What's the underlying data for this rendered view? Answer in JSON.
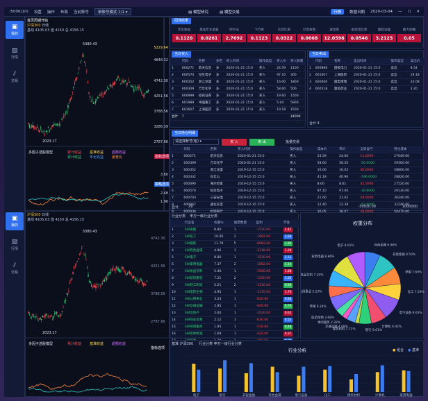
{
  "title_bar": {
    "app_name": "i5006(10)",
    "menu": [
      "设置",
      "操作",
      "布局",
      "当前账号"
    ],
    "mode_select": "单账号模式 1/1",
    "center_tabs": [
      "模型研究",
      "模型交易"
    ],
    "right_pill": "行情",
    "right_text": "数据日期",
    "date": "2020-03-04"
  },
  "rail_top": {
    "items": [
      {
        "label": "我的",
        "icon": "monitor-icon"
      },
      {
        "label": "行情",
        "icon": "image-icon"
      },
      {
        "label": "交易",
        "icon": "slash-icon"
      }
    ]
  },
  "rail_bottom": {
    "items": [
      {
        "label": "我的",
        "icon": "monitor-icon"
      },
      {
        "label": "行情",
        "icon": "image-icon"
      },
      {
        "label": "交易",
        "icon": "slash-icon"
      }
    ]
  },
  "top_chart": {
    "header_title": "首页周期开始",
    "index_name": "沪深300",
    "indicators": "日线",
    "sub": "基线 4105.03 值 4150 总 4156.15",
    "peak_label": "5380.43",
    "low_label": "2023.17",
    "y_ticks": [
      "5229.64",
      "4848.32",
      "4742.30",
      "4251.56",
      "3788.56",
      "3286.39",
      "2787.66"
    ],
    "ind_title": "多因子选股模型",
    "ind_legend": [
      "累计收益",
      "基准收益",
      "超额收益"
    ],
    "ind_legend2": [
      "累计收益",
      "年化收益",
      "夏普比"
    ],
    "ind_ticks": [
      "3.60",
      "3.08",
      "2.48",
      "1.96",
      "1.44",
      "0.92"
    ],
    "right_badges": [
      "指标选项",
      "策略选项"
    ]
  },
  "bottom_chart": {
    "index_name": "沪深300",
    "indicators": "日线",
    "sub": "基线 4105.03 值 4150 总 4156.15",
    "peak_label": "5380.43",
    "low_label": "2023.17",
    "y_ticks": [
      "5229.64",
      "4742.30",
      "4251.56",
      "3788.56",
      "3286.39",
      "2787.66"
    ],
    "ind_title": "多因子选股模型",
    "ind_legend": [
      "累计收益",
      "基准收益",
      "超额收益"
    ],
    "right_badges": [
      "指标选项"
    ]
  },
  "stats": {
    "title": "回测结果",
    "items": [
      {
        "label": "年化收益",
        "value": "0.1120"
      },
      {
        "label": "基准年化收益",
        "value": "0.0261"
      },
      {
        "label": "阿尔法",
        "value": "2.7692"
      },
      {
        "label": "下行率",
        "value": "0.1123"
      },
      {
        "label": "信息比率",
        "value": "0.0322"
      },
      {
        "label": "贝塔系数",
        "value": "0.0068"
      },
      {
        "label": "波动率",
        "value": "12.0596"
      },
      {
        "label": "索提诺比率",
        "value": "0.0546"
      },
      {
        "label": "跟踪误差",
        "value": "3.2125"
      },
      {
        "label": "最大回撤",
        "value": "0.05"
      }
    ]
  },
  "buy_table": {
    "title": "当日买入",
    "columns": [
      "",
      "代码",
      "名称",
      "多空",
      "买入时间",
      "操作类型",
      "买入价",
      "买入数量"
    ],
    "rows": [
      [
        "1",
        "600271",
        "航天信息",
        "多",
        "2020-01-21 15:0",
        "买入",
        "24.59",
        "1100"
      ],
      [
        "2",
        "600570",
        "恒生电子",
        "多",
        "2020-01-21 15:0",
        "买入",
        "97.10",
        "300"
      ],
      [
        "3",
        "600352",
        "浙江龙盛",
        "多",
        "2020-01-21 15:0",
        "买入",
        "16.00",
        "1800"
      ],
      [
        "4",
        "600309",
        "万华化学",
        "多",
        "2020-01-21 15:0",
        "买入",
        "58.60",
        "500"
      ],
      [
        "5",
        "600999",
        "招商证券",
        "多",
        "2020-01-21 15:0",
        "买入",
        "19.60",
        "1500"
      ],
      [
        "6",
        "601989",
        "中国重工",
        "多",
        "2020-01-21 15:0",
        "买入",
        "5.04",
        "5900"
      ],
      [
        "7",
        "601607",
        "上海医药",
        "多",
        "2020-01-21 15:0",
        "买入",
        "19.18",
        "1500"
      ]
    ],
    "sum_label": "合计",
    "sum_count": "7",
    "sum_qty": "14000"
  },
  "sell_table": {
    "title": "当日卖出",
    "columns": [
      "",
      "代码",
      "名称",
      "卖出时间",
      "操作类型",
      "卖出价"
    ],
    "rows": [
      [
        "1",
        "600886",
        "国投电力",
        "2020-01-21 15:0",
        "卖出",
        "8.54"
      ],
      [
        "2",
        "601607",
        "上海医药",
        "2020-01-21 15:0",
        "卖出",
        "19.18"
      ],
      [
        "3",
        "600406",
        "国电南瑞",
        "2020-01-21 15:0",
        "卖出",
        "24.08"
      ],
      [
        "4",
        "600518",
        "康美药业",
        "2020-01-21 15:0",
        "卖出",
        "3.20"
      ]
    ],
    "sum_label": "合计",
    "sum_count": "4"
  },
  "hold_table": {
    "title": "当日持仓明细",
    "select_label": "请选择账号(组)",
    "btn_buy": "买 入",
    "btn_sell": "卖 出",
    "btn_batch": "批量交易",
    "columns": [
      "",
      "代码",
      "名称",
      "买入时间",
      "操作类型",
      "成本价",
      "市价",
      "当日盈亏",
      "持仓成本"
    ],
    "rows": [
      [
        "1",
        "600271",
        "航天信息",
        "2020-01-21 15:0",
        "买入",
        "24.59",
        "24.60",
        "11.0000",
        "27049.00"
      ],
      [
        "2",
        "600309",
        "万华化学",
        "2020-01-21 15:0",
        "买入",
        "58.60",
        "58.50",
        "-50.0000",
        "29300.00"
      ],
      [
        "3",
        "600352",
        "浙江龙盛",
        "2019-12-15 15:0",
        "买入",
        "16.00",
        "16.02",
        "36.0000",
        "28800.00"
      ],
      [
        "4",
        "600332",
        "白云山",
        "2019-12-15 15:0",
        "买入",
        "41.18",
        "40.90",
        "-196.0000",
        "28826.00"
      ],
      [
        "5",
        "600690",
        "海尔智家",
        "2019-12-15 15:0",
        "买入",
        "8.60",
        "8.61",
        "32.0000",
        "27520.00"
      ],
      [
        "6",
        "600570",
        "恒生电子",
        "2019-12-15 15:0",
        "买入",
        "97.10",
        "97.00",
        "-30.0000",
        "29130.00"
      ],
      [
        "7",
        "600703",
        "三安光电",
        "2019-12-15 15:0",
        "买入",
        "21.60",
        "21.62",
        "28.0000",
        "30240.00"
      ],
      [
        "8",
        "600867",
        "通化东宝",
        "2019-12-15 15:0",
        "买入",
        "12.40",
        "12.38",
        "-52.0000",
        "32240.00"
      ],
      [
        "9",
        "600036",
        "招商银行",
        "2019-12-15 15:0",
        "买入",
        "36.05",
        "36.07",
        "28.0000",
        "50470.00"
      ],
      [
        "10",
        "600999",
        "招商证券",
        "2020-01-21 15:0",
        "买入",
        "19.60",
        "19.62",
        "30.0000",
        "29400.00"
      ],
      [
        "11",
        "601989",
        "中国重工",
        "2020-01-21 15:0",
        "买入",
        "5.04",
        "5.03",
        "-59.0000",
        "29736.00"
      ]
    ],
    "sum_label": "合计",
    "sum_count": "29",
    "sum_pnl": "-30930.00",
    "sum_cost": "1000000"
  },
  "industry_table": {
    "tabs": [
      "行业分类",
      "申万一级行业分类"
    ],
    "columns": [
      "",
      "行业名",
      "权重%",
      "股票数量",
      "盈利",
      "市值"
    ],
    "rows": [
      [
        "1",
        "SW采掘",
        "8.80",
        "1",
        "-1510.00",
        "2.47"
      ],
      [
        "2",
        "SW化工",
        "10.00",
        "2",
        "-1082.00",
        "2.68"
      ],
      [
        "3",
        "SW钢铁",
        "11.79",
        "5",
        "-6082.00",
        "1.95"
      ],
      [
        "4",
        "SW有色金属",
        "4.96",
        "1",
        "-2218.00",
        "1.29"
      ],
      [
        "5",
        "SW电子",
        "8.80",
        "1",
        "-1510.00",
        "3.12"
      ],
      [
        "6",
        "SW家用电器",
        "7.37",
        "2",
        "-1862.00",
        "2.21"
      ],
      [
        "7",
        "SW食品饮料",
        "5.40",
        "1",
        "-3500.00",
        "1.88"
      ],
      [
        "8",
        "SW纺织服装",
        "7.21",
        "2",
        "-1250.00",
        "1.02"
      ],
      [
        "9",
        "SW轻工制造",
        "5.21",
        "2",
        "-1110.00",
        "0.94"
      ],
      [
        "10",
        "SW医药生物",
        "4.95",
        "1",
        "-1370.00",
        "1.76"
      ],
      [
        "11",
        "SW公用事业",
        "3.24",
        "1",
        "-820.00",
        "0.88"
      ],
      [
        "12",
        "SW交通运输",
        "2.85",
        "1",
        "-940.00",
        "0.74"
      ],
      [
        "13",
        "SW房地产",
        "2.60",
        "1",
        "-1020.00",
        "0.61"
      ],
      [
        "14",
        "SW商业贸易",
        "2.12",
        "1",
        "-630.00",
        "0.52"
      ],
      [
        "15",
        "SW休闲服务",
        "1.95",
        "1",
        "-510.00",
        "0.48"
      ],
      [
        "16",
        "SW农林牧渔",
        "1.69",
        "1",
        "-420.00",
        "0.37"
      ],
      [
        "17",
        "SW综合",
        "1.20",
        "1",
        "-300.00",
        "0.29"
      ]
    ],
    "sum_label": "合计",
    "sum_w": "100.00",
    "sum_n": "29",
    "sum_pnl": "-43328.00",
    "sum_mv": "100.0"
  },
  "pie": {
    "title": "权重分布",
    "labels": [
      "有色金属 6.96%",
      "非银金融 8.50%",
      "采掘 7.69%",
      "化工 7.29%",
      "电气设备 9.63%",
      "计算机 6.92%",
      "银行 5.61%",
      "建筑材料 1.72%",
      "交通运输 4.08%",
      "休闲服务 2.28%",
      "医药生物 3.68%",
      "传媒 6.34%",
      "公用事业 5.23%",
      "食品饮料 7.20%",
      "家用电器 8.86%",
      "电子 8.01%"
    ]
  },
  "bars": {
    "tabs": [
      "基准 沪深300",
      "行业分类 申万一级行业分类"
    ],
    "title": "行业分析",
    "legend": [
      "组合",
      "基准"
    ],
    "categories": [
      "电子",
      "银行",
      "非银金融",
      "有色金属",
      "电气设备",
      "化工",
      "建筑材料",
      "计算机",
      "家用电器"
    ]
  },
  "chart_data": [
    {
      "type": "pie",
      "title": "权重分布",
      "labels": [
        "有色金属",
        "非银金融",
        "采掘",
        "化工",
        "电气设备",
        "计算机",
        "银行",
        "建筑材料",
        "交通运输",
        "休闲服务",
        "医药生物",
        "传媒",
        "公用事业",
        "食品饮料",
        "家用电器",
        "电子"
      ],
      "values": [
        6.96,
        8.5,
        7.69,
        7.29,
        9.63,
        6.92,
        5.61,
        1.72,
        4.08,
        2.28,
        3.68,
        6.34,
        5.23,
        7.2,
        8.86,
        8.01
      ],
      "colors": [
        "#3c7df0",
        "#2ec4c4",
        "#ff8a3c",
        "#ffd23c",
        "#8f5cf0",
        "#f04f6e",
        "#2ed07a",
        "#c0d84a",
        "#5aa0ff",
        "#ff5ac8",
        "#4ae0a0",
        "#7d6bff",
        "#ff6f4a",
        "#37b3ff",
        "#e0e040",
        "#b05cff"
      ]
    },
    {
      "type": "bar",
      "title": "行业分析",
      "categories": [
        "电子",
        "银行",
        "非银金融",
        "有色金属",
        "电气设备",
        "化工",
        "建筑材料",
        "计算机",
        "家用电器"
      ],
      "series": [
        {
          "name": "组合",
          "values": [
            0.78,
            0.65,
            0.52,
            0.7,
            0.45,
            0.62,
            0.35,
            0.55,
            0.6
          ]
        },
        {
          "name": "基准",
          "values": [
            0.62,
            0.88,
            0.8,
            0.55,
            0.7,
            0.72,
            0.5,
            0.74,
            0.58
          ]
        }
      ],
      "ylim": [
        0,
        1
      ]
    }
  ],
  "colors": {
    "accent": "#2f6ff0",
    "red_stat": "#b8143a",
    "bar_a": "#f5c330",
    "bar_b": "#3d7df0"
  }
}
